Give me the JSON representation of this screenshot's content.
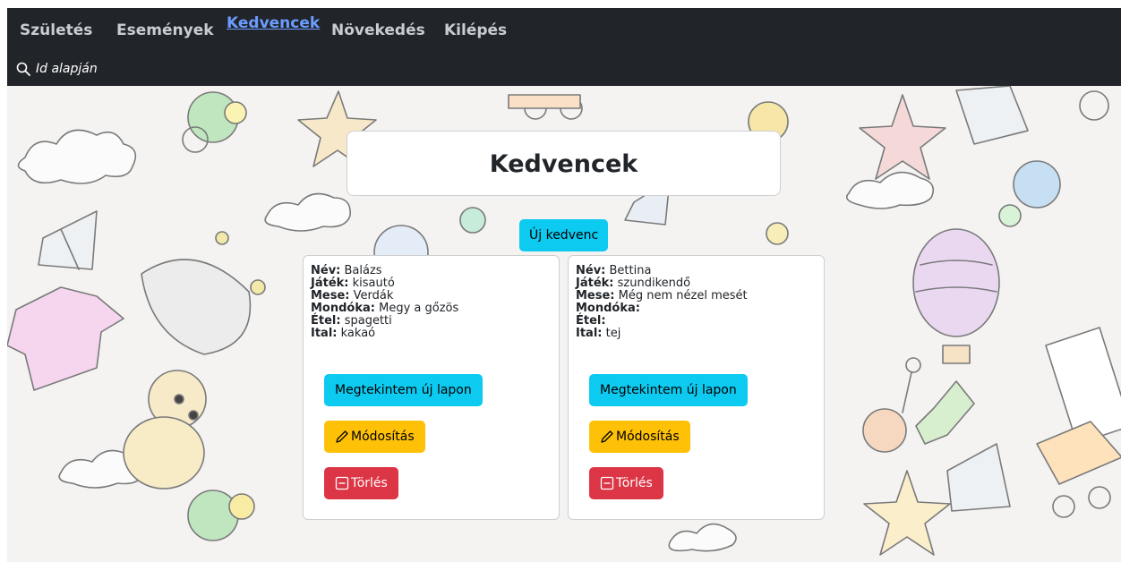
{
  "nav": {
    "items": [
      {
        "label": "Születés"
      },
      {
        "label": "Események"
      },
      {
        "label": "Kedvencek"
      },
      {
        "label": "Növekedés"
      },
      {
        "label": "Kilépés"
      }
    ],
    "active": "Kedvencek"
  },
  "search": {
    "label": "Id alapján",
    "icon": "search-icon"
  },
  "page": {
    "title": "Kedvencek",
    "new_button": "Új kedvenc"
  },
  "field_labels": {
    "name": "Név:",
    "toy": "Játék:",
    "tale": "Mese:",
    "rhyme": "Mondóka:",
    "food": "Étel:",
    "drink": "Ital:"
  },
  "buttons": {
    "view": "Megtekintem új lapon",
    "edit": "Módosítás",
    "delete": "Törlés"
  },
  "cards": [
    {
      "name": "Balázs",
      "toy": "kisautó",
      "tale": "Verdák",
      "rhyme": "Megy a gőzös",
      "food": "spagetti",
      "drink": "kakaó"
    },
    {
      "name": "Bettina",
      "toy": "szundikendő",
      "tale": "Még nem nézel mesét",
      "rhyme": "",
      "food": "",
      "drink": "tej"
    }
  ],
  "colors": {
    "navbar": "#212529",
    "info": "#0dcaf0",
    "warning": "#ffc107",
    "danger": "#dc3545",
    "active_link": "#6b9cff"
  }
}
